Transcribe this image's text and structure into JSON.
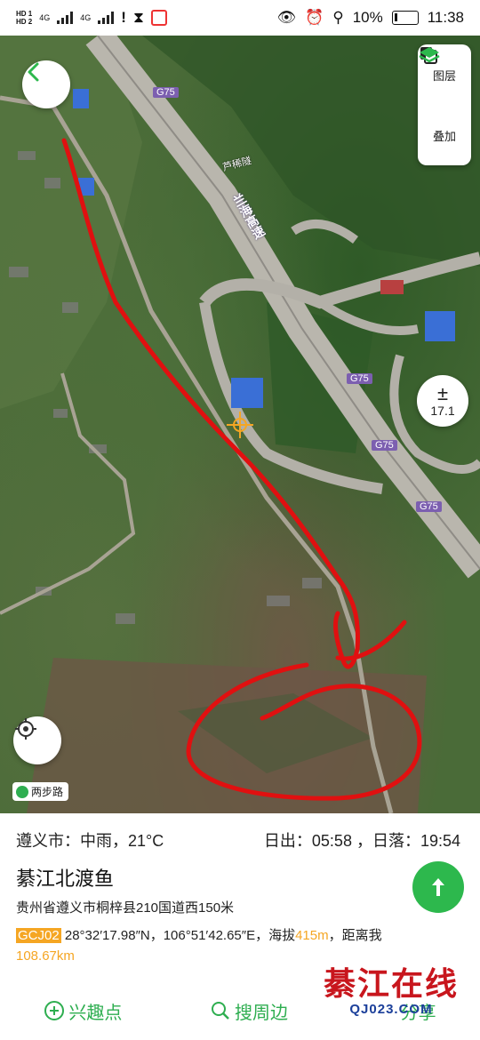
{
  "status_bar": {
    "hd1": "HD 1",
    "hd2": "HD 2",
    "net1": "4G",
    "net2": "4G",
    "battery_pct": "10%",
    "time": "11:38"
  },
  "map": {
    "road_labels": [
      "G75",
      "G75",
      "G75",
      "G75"
    ],
    "road_name_vertical": "兰海高速",
    "tunnel_name": "芦稀隧",
    "layers_label": "图层",
    "overlay_label": "叠加",
    "zoom_symbol": "±",
    "zoom_level": "17.1",
    "walk_tag": "两步路",
    "accent_color": "#2db84d",
    "annotation_color": "#e01010"
  },
  "info": {
    "weather": "遵义市：中雨，21°C",
    "sun": "日出：05:58 ，日落：19:54",
    "place_title": "綦江北渡鱼",
    "address": "贵州省遵义市桐梓县210国道西150米",
    "coord_system": "GCJ02",
    "coords": " 28°32′17.98″N，106°51′42.65″E，海拔",
    "altitude": "415m",
    "distance_prefix": "，距离我",
    "distance": "108.67km"
  },
  "actions": {
    "poi": "兴趣点",
    "nearby": "搜周边",
    "share": "分享"
  },
  "watermark": {
    "main": "綦江在线",
    "sub": "QJ023.COM"
  }
}
